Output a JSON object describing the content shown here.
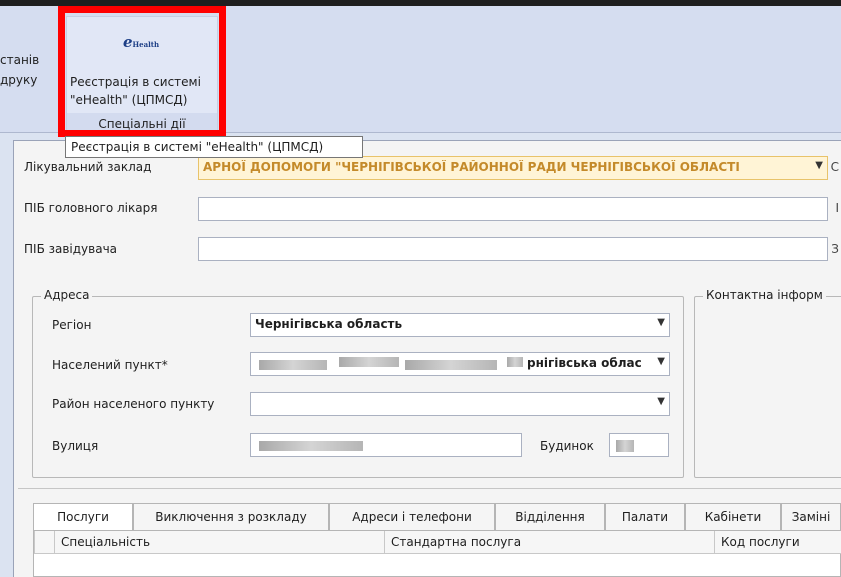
{
  "ribbon": {
    "left_lines": [
      "станів",
      "друку"
    ],
    "logo_letter": "e",
    "logo_word": "Health",
    "button_label_line1": "Реєстрація в системі",
    "button_label_line2": "\"eHealth\" (ЦПМСД)",
    "group_caption": "Спеціальні дії"
  },
  "tooltip": {
    "text": "Реєстрація в системі \"eHealth\" (ЦПМСД)"
  },
  "form": {
    "facility_label": "Лікувальний заклад",
    "facility_value": "АРНОЇ ДОПОМОГИ \"ЧЕРНІГІВСЬКОЇ РАЙОННОЇ РАДИ ЧЕРНІГІВСЬКОЇ ОБЛАСТІ",
    "chief_doctor_label": "ПІБ головного лікаря",
    "chief_doctor_value": "",
    "head_label": "ПІБ завідувача",
    "head_value": "",
    "address": {
      "legend": "Адреса",
      "region_label": "Регіон",
      "region_value": "Чернігівська область",
      "settlement_label": "Населений пункт*",
      "settlement_value": "рнігівська облас",
      "district_label": "Район населеного пункту",
      "district_value": "",
      "street_label": "Вулиця",
      "building_label": "Будинок"
    },
    "contact": {
      "legend": "Контактна інформ"
    }
  },
  "tabs": [
    {
      "label": "Послуги",
      "active": true
    },
    {
      "label": "Виключення з розкладу",
      "active": false
    },
    {
      "label": "Адреси і телефони",
      "active": false
    },
    {
      "label": "Відділення",
      "active": false
    },
    {
      "label": "Палати",
      "active": false
    },
    {
      "label": "Кабінети",
      "active": false
    },
    {
      "label": "Заміні",
      "active": false
    }
  ],
  "grid": {
    "columns": [
      "Спеціальність",
      "Стандартна послуга",
      "Код послуги"
    ]
  }
}
